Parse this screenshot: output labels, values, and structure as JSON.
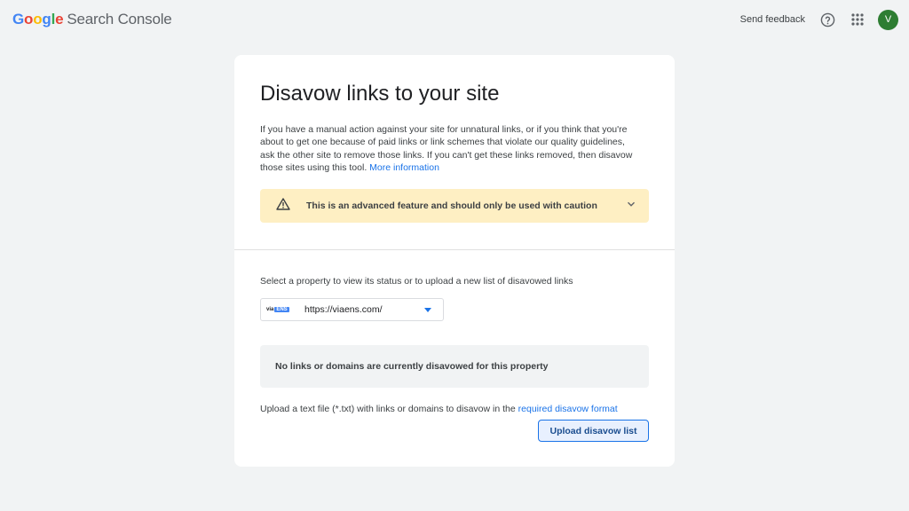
{
  "header": {
    "logo_google": [
      "G",
      "o",
      "o",
      "g",
      "l",
      "e"
    ],
    "logo_product": "Search Console",
    "send_feedback": "Send feedback",
    "avatar_initial": "V",
    "icons": [
      "help-icon",
      "apps-grid-icon"
    ]
  },
  "page": {
    "title": "Disavow links to your site",
    "intro": "If you have a manual action against your site for unnatural links, or if you think that you're about to get one because of paid links or link schemes that violate our quality guidelines, ask the other site to remove those links. If you can't get these links removed, then disavow those sites using this tool.",
    "intro_link": "More information",
    "warning": "This is an advanced feature and should only be used with caution",
    "select_label": "Select a property to view its status or to upload a new list of disavowed links",
    "property": {
      "logo_text": "via",
      "logo_pill": "ENS",
      "url": "https://viaens.com/"
    },
    "status": "No links or domains are currently disavowed for this property",
    "upload_text": "Upload a text file (*.txt) with links or domains to disavow in the",
    "upload_link": "required disavow format",
    "upload_button": "Upload disavow list"
  },
  "colors": {
    "background": "#f1f3f4",
    "warning_bg": "#feefc3",
    "link": "#1a73e8",
    "avatar": "#2e7d32"
  }
}
